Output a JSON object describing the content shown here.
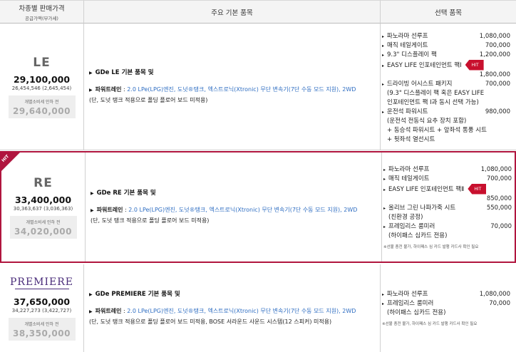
{
  "header": {
    "col1_main": "차종별 판매가격",
    "col1_sub": "공급가액(부가세)",
    "col2": "주요 기본 품목",
    "col3": "선택 품목"
  },
  "trims": [
    {
      "name": "LE",
      "price": "29,100,000",
      "price_sub": "26,454,546 (2,645,454)",
      "tax_label": "개별소비세 인하 전",
      "tax_value": "29,640,000",
      "package": "GDe LE 기본 품목 및",
      "pt_label": "파워트레인",
      "pt_colon": " : ",
      "pt_value": "2.0 LPe(LPG)엔진, 도넛®탱크, 엑스트로닉(Xtronic) 무단 변속기(7단 수동 모드 지원), 2WD",
      "desc2": "(단, 도넛 탱크 적용으로 폴딩 플로어 보드 미적용)",
      "options": [
        {
          "name": "파노라마 선루프",
          "price": "1,080,000"
        },
        {
          "name": "매직 테일게이트",
          "price": "700,000"
        },
        {
          "name": "9.3\" 디스플레이 팩",
          "price": "1,200,000"
        },
        {
          "name": "EASY LIFE 인포테인먼트 팩Ⅰ",
          "badge": "HIT",
          "price2": "1,800,000"
        },
        {
          "name": "드라이빙 어시스트 패키지",
          "price": "700,000",
          "cont": [
            "(9.3\" 디스플레이 팩 혹은 EASY LIFE",
            "인포테인먼트 팩 Ⅰ과 동시 선택 가능)"
          ]
        },
        {
          "name": "운전석 파워시트",
          "price": "980,000",
          "cont": [
            "(운전석 전동식 요추 장치 포함)",
            "+ 동승석 파워시트 + 앞좌석 통풍 시트",
            "+ 뒷좌석 열선시트"
          ]
        }
      ]
    },
    {
      "name": "RE",
      "ribbon": "HIT",
      "price": "33,400,000",
      "price_sub": "30,363,637 (3,036,363)",
      "tax_label": "개별소비세 인하 전",
      "tax_value": "34,020,000",
      "package": "GDe RE 기본 품목 및",
      "pt_label": "파워트레인",
      "pt_colon": " : ",
      "pt_value": "2.0 LPe(LPG)엔진, 도넛®탱크, 엑스트로닉(Xtronic) 무단 변속기(7단 수동 모드 지원), 2WD",
      "desc2": "(단, 도넛 탱크 적용으로 폴딩 플로어 보드 미적용)",
      "options": [
        {
          "name": "파노라마 선루프",
          "price": "1,080,000"
        },
        {
          "name": "매직 테일게이트",
          "price": "700,000"
        },
        {
          "name": "EASY LIFE 인포테인먼트 팩Ⅱ",
          "badge": "HIT",
          "price2": "850,000"
        },
        {
          "name": "올리브 그린 나파가죽 시트",
          "price": "550,000",
          "cont": [
            "(친환경 공정)"
          ]
        },
        {
          "name": "프레임리스 룸미러",
          "price": "70,000",
          "cont": [
            "(하이패스 심카드 전용)"
          ]
        }
      ],
      "note": "※선불 충전 불가, 하이패스 심 카드 발행 카드사 확인 필요"
    },
    {
      "logo": "PREMIERE",
      "price": "37,650,000",
      "price_sub": "34,227,273 (3,422,727)",
      "tax_label": "개별소비세 인하 전",
      "tax_value": "38,350,000",
      "package": "GDe PREMIERE 기본 품목 및",
      "pt_label": "파워트레인",
      "pt_colon": " : ",
      "pt_value": "2.0 LPe(LPG)엔진, 도넛®탱크, 엑스트로닉(Xtronic) 무단 변속기(7단 수동 모드 지원), 2WD",
      "desc2": "(단, 도넛 탱크 적용으로 폴딩 플로어 보드 미적용, BOSE 서라운드 사운드 시스템(12 스피커) 미적용)",
      "options": [
        {
          "name": "파노라마 선루프",
          "price": "1,080,000"
        },
        {
          "name": "프레임리스 룸미러",
          "price": "70,000",
          "cont": [
            "(하이패스 심카드 전용)"
          ]
        }
      ],
      "note": "※선불 충전 불가, 하이패스 심 카드 발행 카드사 확인 필요"
    }
  ]
}
